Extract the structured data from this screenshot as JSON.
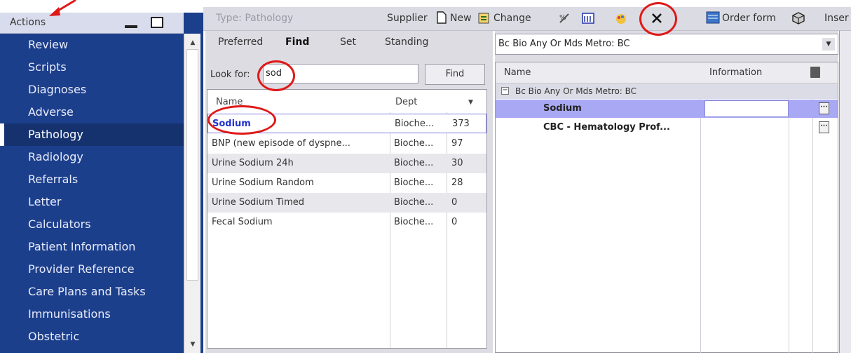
{
  "actions_panel": {
    "title": "Actions",
    "nav_items": [
      {
        "label": "Review",
        "selected": false
      },
      {
        "label": "Scripts",
        "selected": false
      },
      {
        "label": "Diagnoses",
        "selected": false
      },
      {
        "label": "Adverse",
        "selected": false
      },
      {
        "label": "Pathology",
        "selected": true
      },
      {
        "label": "Radiology",
        "selected": false
      },
      {
        "label": "Referrals",
        "selected": false
      },
      {
        "label": "Letter",
        "selected": false
      },
      {
        "label": "Calculators",
        "selected": false
      },
      {
        "label": "Patient Information",
        "selected": false
      },
      {
        "label": "Provider Reference",
        "selected": false
      },
      {
        "label": "Care Plans and Tasks",
        "selected": false
      },
      {
        "label": "Immunisations",
        "selected": false
      },
      {
        "label": "Obstetric",
        "selected": false
      }
    ]
  },
  "toolbar": {
    "type_label": "Type: Pathology",
    "supplier_label": "Supplier",
    "new_label": "New",
    "change_label": "Change",
    "order_form_label": "Order form",
    "insert_label": "Inser"
  },
  "find_pane": {
    "tabs": [
      {
        "label": "Preferred",
        "active": false
      },
      {
        "label": "Find",
        "active": true
      },
      {
        "label": "Set",
        "active": false
      },
      {
        "label": "Standing",
        "active": false
      }
    ],
    "lookfor_label": "Look for:",
    "lookfor_value": "sod",
    "find_button": "Find",
    "columns": {
      "name": "Name",
      "dept": "Dept"
    },
    "rows": [
      {
        "name": "Sodium",
        "dept": "Bioche...",
        "count": "373"
      },
      {
        "name": "BNP (new episode of dyspne...",
        "dept": "Bioche...",
        "count": "97"
      },
      {
        "name": "Urine Sodium 24h",
        "dept": "Bioche...",
        "count": "30"
      },
      {
        "name": "Urine Sodium Random",
        "dept": "Bioche...",
        "count": "28"
      },
      {
        "name": "Urine Sodium Timed",
        "dept": "Bioche...",
        "count": "0"
      },
      {
        "name": "Fecal Sodium",
        "dept": "Bioche...",
        "count": "0"
      }
    ]
  },
  "order_pane": {
    "selected_lab": "Bc Bio Any Or Mds Metro: BC",
    "columns": {
      "name": "Name",
      "information": "Information"
    },
    "group_label": "Bc Bio Any Or Mds Metro: BC",
    "rows": [
      {
        "name": "Sodium"
      },
      {
        "name": "CBC - Hematology Prof..."
      }
    ]
  },
  "colors": {
    "panel_blue": "#1c3f8c",
    "annotation_red": "#e01818",
    "selection_purple": "#a8a8f4"
  }
}
